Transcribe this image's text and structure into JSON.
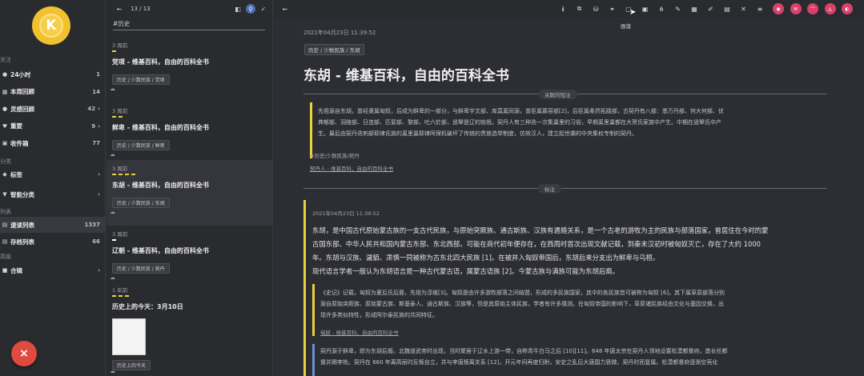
{
  "sidebar": {
    "avatar_letter": "K",
    "section_follow": "关注",
    "items": [
      {
        "label": "24小时",
        "count": "1",
        "icon": "clock-icon",
        "glyph": "●"
      },
      {
        "label": "本周回顾",
        "count": "14",
        "icon": "calendar-icon",
        "glyph": "▦"
      },
      {
        "label": "灵感回顾",
        "count": "42",
        "icon": "bulb-icon",
        "glyph": "●",
        "chev": "›"
      },
      {
        "label": "重要",
        "count": "9",
        "icon": "heart-icon",
        "glyph": "♥",
        "chev": "›"
      },
      {
        "label": "收件箱",
        "count": "77",
        "icon": "inbox-icon",
        "glyph": "▣"
      }
    ],
    "section_category": "分类",
    "cat_items": [
      {
        "label": "标签",
        "icon": "tag-icon",
        "glyph": "◆",
        "chev": "›"
      },
      {
        "label": "智能分类",
        "icon": "filter-icon",
        "glyph": "▼",
        "chev": "›"
      }
    ],
    "section_list": "列表",
    "list_items": [
      {
        "label": "速读列表",
        "count": "1337",
        "icon": "list-icon",
        "glyph": "▤"
      },
      {
        "label": "存档列表",
        "count": "66",
        "icon": "archive-icon",
        "glyph": "▤"
      }
    ],
    "section_advanced": "高级",
    "adv_items": [
      {
        "label": "合辑",
        "icon": "collection-icon",
        "glyph": "■",
        "chev": "›"
      }
    ],
    "fab_label": "×"
  },
  "list": {
    "pager": "13 / 13",
    "search_value": "#历史",
    "cards": [
      {
        "date": "3 周前",
        "title": "党项 - 维基百科，自由的百科全书",
        "tag": "历史 / 少数民族 / 党项",
        "dash_color": "#e8d23a",
        "dashes": 1
      },
      {
        "date": "3 周前",
        "title": "鲜卑 - 维基百科，自由的百科全书",
        "tag": "历史 / 少数民族 / 鲜卑",
        "dash_color": "#e8d23a",
        "dashes": 2
      },
      {
        "date": "3 周前",
        "title": "东胡 - 维基百科，自由的百科全书",
        "tag": "历史 / 少数民族 / 东胡",
        "dash_color": "#e8d23a",
        "dashes": 4
      },
      {
        "date": "3 周前",
        "title": "辽朝 - 维基百科，自由的百科全书",
        "tag": "历史 / 少数民族 / 契丹",
        "dash_color": "#ffffff",
        "dashes": 1
      },
      {
        "date": "1 年前",
        "title": "历史上的今天：3月10日",
        "tag": "历史上的今天",
        "dash_color": "#e8d23a",
        "dashes": 3
      }
    ],
    "cloud_icon": "☁"
  },
  "toolbar": {
    "tooltip": "画谱",
    "icons": [
      "info-icon",
      "copy-icon",
      "database-icon",
      "link-icon",
      "frame-icon",
      "cursor-icon",
      "tree-icon",
      "tag-edit-icon",
      "grid-icon",
      "pen-icon",
      "archive-box-icon",
      "delete-icon",
      "menu-icon"
    ],
    "glyphs": [
      "ℹ",
      "⧉",
      "⛁",
      "⚭",
      "▢",
      "▣",
      "⋔",
      "✎",
      "▦",
      "✐",
      "▤",
      "✕",
      "≡"
    ],
    "round_icons": [
      "share-icon",
      "mail-icon",
      "open-icon",
      "pdf-icon",
      "export-icon"
    ],
    "round_glyphs": [
      "◉",
      "✉",
      "⌒",
      "◬",
      "◐"
    ]
  },
  "article": {
    "date": "2021年04月23日 11:39:52",
    "tag": "历史 / 少数民族 / 东胡",
    "title": "东胡 - 维基百科，自由的百科全书",
    "related_pill": "关联的短注",
    "related_text_1": "先祖源自东胡，曾经隶属匈奴，后成为鲜卑的一部分，与鲜卑宇文部、库莫奚同源，曾臣属慕容部[2]，后臣属柔然拓跋部，古契丹有八部：悉万丹部、何大何部、伏",
    "related_text_2": "弗郁部、羽陵部、日连部、匹絜部、黎部、吐六於部，遥辇是辽的始祖。契丹人有三种迭一次集巢里的习俗，早期奚里巢都在大贺氏家族中产生。中期在遥辇氏中产",
    "related_text_3": "生。最后由契丹迭刺部耶律氏族的奚里巢耶律阿保机破坏了传统的贵族选举制度，仿效汉人，建立起世袭的中央集权专制的契丹。",
    "related_tag": "#历史/少数民族/契丹",
    "related_link": "契丹人 - 维基百科，自由的百科全书",
    "notes_pill": "标注",
    "note_date": "2021年04月23日 11:39:52",
    "main_1": "东胡，是中国古代原始蒙古族的一支古代民族，与原始突厥族、通古斯族、汉族有遇婚关系，是一个古老的游牧为主的民族与部落国家，曾居住在今时的蒙",
    "main_2": "古国东部、中华人民共和国内蒙古东部、东北西部。可能在商代初年便存在，在西周时首次出现文献记载，到秦末汉初时被匈奴灭亡，存在了大约 1000",
    "main_3": "年。东胡与汉族、濊貊、肃慎一同被称为古东北四大民族 [1]。在被并入匈奴帝国后，东胡后来分支出为鲜卑与乌桓。",
    "main_4": "现代语言学者一般认为东胡语言是一种古代蒙古语，属蒙古语族 [2]。今蒙古族与满族可能为东胡后裔。",
    "quote_1": "《史记》记载，匈奴为夏后氏后裔，先祖为淳维[3]。匈奴是由许多游牧部落之间结盟，形成的多民族国家，其中的各民族皆可被称为匈奴 [6]，其下属草原部落分别",
    "quote_2": "源自原始突厥族、原始蒙古族、斯基泰人、通古斯族、汉族等，但是其原始主体民族，学者有许多猜测。在匈奴帝国的影响下，草原诸民族经由文化与基因交换，出",
    "quote_3": "现许多类似特性，形成阿尔泰民族的共同特征。",
    "quote_link": "匈奴 - 维基百科，自由的百科全书",
    "blue_1": "契丹源于鲜卑，即为东胡后裔。北魏道武帝时出现，当时聚居于辽水上游一带，自称青牛白马之后 [10][11]。648 年唐太宗在契丹人领地设置松漠都督府，酋长任都",
    "blue_2": "督并赐李姓。契丹在 660 年离高丽时反叛自立，并与李唐叛离关系 [12]，开元年间再度归附，安史之乱后大唐国力衰微，契丹时而复属。松漠都督府逐渐空壳化"
  }
}
